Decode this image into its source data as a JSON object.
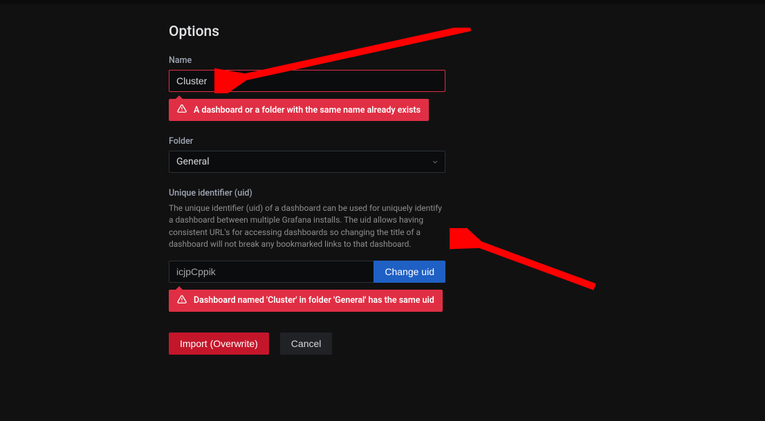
{
  "title": "Options",
  "fields": {
    "name": {
      "label": "Name",
      "value": "Cluster",
      "error": "A dashboard or a folder with the same name already exists"
    },
    "folder": {
      "label": "Folder",
      "value": "General"
    },
    "uid": {
      "label": "Unique identifier (uid)",
      "help": "The unique identifier (uid) of a dashboard can be used for uniquely identify a dashboard between multiple Grafana installs. The uid allows having consistent URL's for accessing dashboards so changing the title of a dashboard will not break any bookmarked links to that dashboard.",
      "value": "icjpCppik",
      "change_label": "Change uid",
      "error": "Dashboard named 'Cluster' in folder 'General' has the same uid"
    }
  },
  "buttons": {
    "import": "Import (Overwrite)",
    "cancel": "Cancel"
  }
}
